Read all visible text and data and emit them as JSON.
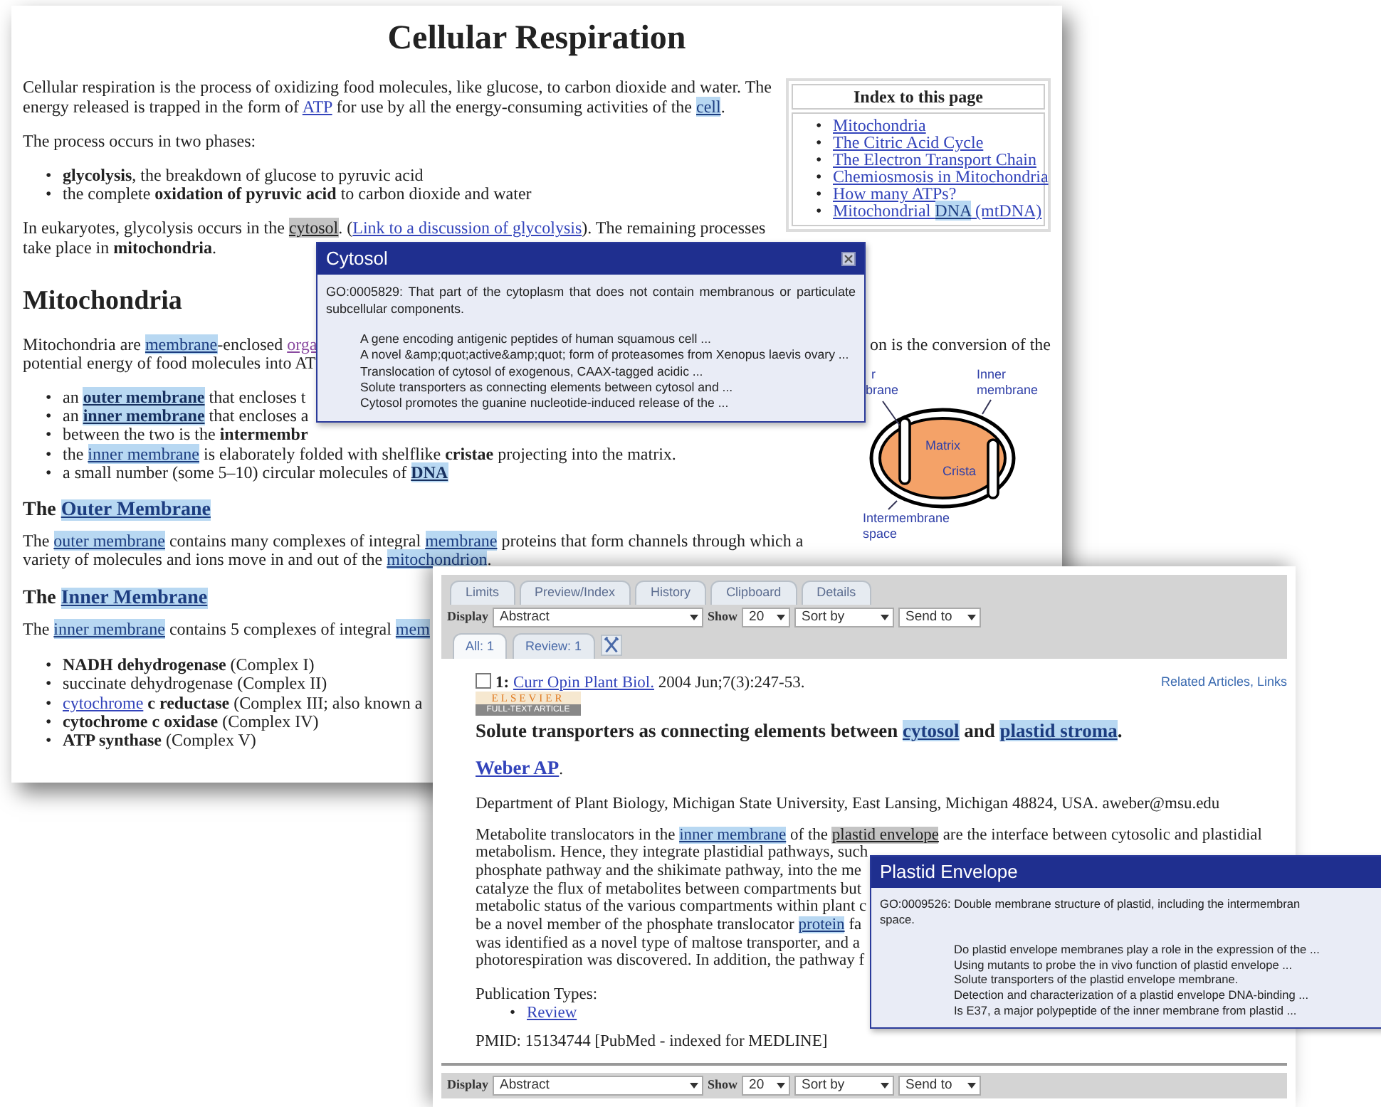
{
  "back_page": {
    "title": "Cellular Respiration",
    "intro": [
      {
        "kind": "text",
        "text": "Cellular respiration is the process of oxidizing food molecules, like glucose, to carbon dioxide and water. The energy released is trapped in the form of "
      },
      {
        "kind": "link",
        "text": "ATP"
      },
      {
        "kind": "text",
        "text": " for use by all the energy-consuming activities of the "
      },
      {
        "kind": "term",
        "text": "cell"
      },
      {
        "kind": "text",
        "text": "."
      }
    ],
    "phases_intro": "The process occurs in two phases:",
    "phases": [
      {
        "bullet": "•",
        "parts": [
          {
            "kind": "text",
            "text": "**glycolysis**, the breakdown of glucose to pyruvic acid"
          }
        ]
      },
      {
        "bullet": "•",
        "parts": [
          {
            "kind": "text",
            "text": "the complete **oxidation of pyruvic acid** to carbon dioxide and water"
          }
        ]
      }
    ],
    "eukaryotes": [
      {
        "kind": "text",
        "text": "In eukaryotes, glycolysis occurs in the "
      },
      {
        "kind": "hover",
        "text": "cytosol"
      },
      {
        "kind": "text",
        "text": ". ("
      },
      {
        "kind": "link",
        "text": "Link to a discussion of glycolysis"
      },
      {
        "kind": "text",
        "text": "). The remaining processes take place in **mitochondria**."
      }
    ],
    "index": {
      "heading": "Index to this page",
      "links": [
        {
          "bullet": "•",
          "parts": [
            {
              "kind": "link",
              "text": "Mitochondria"
            }
          ]
        },
        {
          "bullet": "•",
          "parts": [
            {
              "kind": "link",
              "text": "The Citric Acid Cycle"
            }
          ]
        },
        {
          "bullet": "•",
          "parts": [
            {
              "kind": "link",
              "text": "The Electron Transport Chain"
            }
          ]
        },
        {
          "bullet": "•",
          "parts": [
            {
              "kind": "link",
              "text": "Chemiosmosis in Mitochondria"
            }
          ]
        },
        {
          "bullet": "•",
          "parts": [
            {
              "kind": "link",
              "text": "How many ATPs?"
            }
          ]
        },
        {
          "bullet": "•",
          "parts": [
            {
              "kind": "link",
              "text": "Mitochondrial "
            },
            {
              "kind": "term",
              "text": "DNA"
            },
            {
              "kind": "link",
              "text": " (mtDNA)"
            }
          ]
        }
      ]
    },
    "section_heading": "Mitochondria",
    "mito_lines": [
      {
        "left": [
          {
            "kind": "text",
            "text": "Mitochondria are "
          },
          {
            "kind": "term",
            "text": "membrane"
          },
          {
            "kind": "text",
            "text": "-enclosed "
          },
          {
            "kind": "visited",
            "text": "orga"
          }
        ],
        "right": [
          {
            "kind": "text",
            "text": "on is the conversion of the"
          }
        ]
      },
      {
        "left": [
          {
            "kind": "text",
            "text": "potential energy of food molecules into AT"
          }
        ]
      }
    ],
    "mito_bullets": [
      {
        "bullet": "•",
        "parts": [
          {
            "kind": "text",
            "text": "an "
          },
          {
            "kind": "term_bold",
            "text": "outer membrane"
          },
          {
            "kind": "text",
            "text": " that encloses t"
          }
        ]
      },
      {
        "bullet": "•",
        "parts": [
          {
            "kind": "text",
            "text": "an "
          },
          {
            "kind": "term_bold",
            "text": "inner membrane"
          },
          {
            "kind": "text",
            "text": " that encloses a"
          }
        ]
      },
      {
        "bullet": "•",
        "parts": [
          {
            "kind": "text",
            "text": "between the two is the **intermembr**"
          }
        ]
      },
      {
        "bullet": "•",
        "parts": [
          {
            "kind": "text",
            "text": "the "
          },
          {
            "kind": "term",
            "text": "inner membrane"
          },
          {
            "kind": "text",
            "text": " is elaborately folded with shelflike **cristae** projecting into the matrix."
          }
        ]
      },
      {
        "bullet": "•",
        "parts": [
          {
            "kind": "text",
            "text": "a small number (some 5–10) circular molecules of "
          },
          {
            "kind": "term_bold",
            "text": "DNA"
          }
        ]
      }
    ],
    "outer_heading": [
      {
        "kind": "text",
        "text": "The "
      },
      {
        "kind": "term",
        "text": "Outer Membrane"
      }
    ],
    "outer_text": [
      {
        "kind": "text",
        "text": "The "
      },
      {
        "kind": "term",
        "text": "outer membrane"
      },
      {
        "kind": "text",
        "text": " contains many complexes of integral "
      },
      {
        "kind": "term",
        "text": "membrane"
      },
      {
        "kind": "text",
        "text": " proteins that form channels through which a variety of molecules and ions move in and out of the "
      },
      {
        "kind": "term",
        "text": "mitochondrion"
      },
      {
        "kind": "text",
        "text": "."
      }
    ],
    "inner_heading": [
      {
        "kind": "text",
        "text": "The "
      },
      {
        "kind": "term",
        "text": "Inner Membrane"
      }
    ],
    "inner_text": [
      {
        "kind": "text",
        "text": "The "
      },
      {
        "kind": "term",
        "text": "inner membrane"
      },
      {
        "kind": "text",
        "text": " contains 5 complexes of integral "
      },
      {
        "kind": "term",
        "text": "mem"
      }
    ],
    "complexes": [
      {
        "bullet": "•",
        "parts": [
          {
            "kind": "text",
            "text": "**NADH dehydrogenase** (Complex I)"
          }
        ]
      },
      {
        "bullet": "•",
        "parts": [
          {
            "kind": "text",
            "text": "succinate dehydrogenase (Complex II)"
          }
        ]
      },
      {
        "bullet": "•",
        "parts": [
          {
            "kind": "link",
            "text": "cytochrome"
          },
          {
            "kind": "text",
            "text": " **c reductase** (Complex III; also known a"
          }
        ]
      },
      {
        "bullet": "•",
        "parts": [
          {
            "kind": "text",
            "text": "**cytochrome c oxidase** (Complex IV)"
          }
        ]
      },
      {
        "bullet": "•",
        "parts": [
          {
            "kind": "text",
            "text": "**ATP synthase** (Complex V)"
          }
        ]
      }
    ],
    "diagram": {
      "labels": [
        {
          "kind": "edge",
          "lines": [
            "r",
            "brane"
          ]
        },
        {
          "kind": "inner",
          "lines": [
            "Inner",
            "membrane"
          ]
        },
        {
          "kind": "matrix",
          "lines": [
            "Matrix"
          ]
        },
        {
          "kind": "crista",
          "lines": [
            "Crista"
          ]
        },
        {
          "kind": "space",
          "lines": [
            "Intermembrane",
            "space"
          ]
        }
      ]
    }
  },
  "cytosol_popup": {
    "title": "Cytosol",
    "definition": "GO:0005829: That part of the cytoplasm that does not contain membranous or particulate subcellular components.",
    "links": [
      "A gene encoding antigenic peptides of human squamous cell ...",
      "A novel &amp;quot;active&amp;quot; form of proteasomes from Xenopus laevis ovary ...",
      "Translocation of cytosol of exogenous, CAAX-tagged acidic ...",
      "Solute transporters as connecting elements between cytosol and ...",
      "Cytosol promotes the guanine nucleotide-induced release of the ..."
    ]
  },
  "front_page": {
    "tabs": [
      {
        "label": "Limits",
        "selected": false
      },
      {
        "label": "Preview/Index",
        "selected": false
      },
      {
        "label": "History",
        "selected": false
      },
      {
        "label": "Clipboard",
        "selected": false
      },
      {
        "label": "Details",
        "selected": false
      }
    ],
    "toolbars": [
      {
        "display_label": "Display",
        "display_value": "Abstract",
        "show_label": "Show",
        "show_value": "20",
        "sort": "Sort by",
        "send": "Send to"
      },
      {
        "display_label": "Display",
        "display_value": "Abstract",
        "show_label": "Show",
        "show_value": "20",
        "sort": "Sort by",
        "send": "Send to"
      }
    ],
    "result_tabs": [
      {
        "label": "All: 1",
        "selected": true
      },
      {
        "label": "Review: 1",
        "selected": false
      }
    ],
    "record": {
      "checked": false,
      "number": "1:",
      "journal": "Curr Opin Plant Biol.",
      "citation": "2004 Jun;7(3):247-53.",
      "related": "Related Articles, Links",
      "logo": "ELSEVIER",
      "logo_badge": "FULL-TEXT ARTICLE",
      "title": [
        {
          "kind": "text",
          "text": "Solute transporters as connecting elements between "
        },
        {
          "kind": "term",
          "text": "cytosol"
        },
        {
          "kind": "text",
          "text": " and "
        },
        {
          "kind": "term",
          "text": "plastid stroma"
        },
        {
          "kind": "text",
          "text": "."
        }
      ],
      "author": "Weber AP",
      "author_end": ".",
      "affiliation": "Department of Plant Biology, Michigan State University, East Lansing, Michigan 48824, USA. aweber@msu.edu",
      "abstract_lines": [
        [
          {
            "kind": "text",
            "text": "Metabolite translocators in the "
          },
          {
            "kind": "term",
            "text": "inner membrane"
          },
          {
            "kind": "text",
            "text": " of the "
          },
          {
            "kind": "hover",
            "text": "plastid envelope"
          },
          {
            "kind": "text",
            "text": " are the interface between cytosolic and plastidial"
          }
        ],
        [
          {
            "kind": "text",
            "text": "metabolism. Hence, they integrate plastidial pathways, such"
          }
        ],
        [
          {
            "kind": "text",
            "text": "phosphate pathway and the shikimate pathway, into the me"
          }
        ],
        [
          {
            "kind": "text",
            "text": "catalyze the flux of metabolites between compartments but"
          }
        ],
        [
          {
            "kind": "text",
            "text": "metabolic status of the various compartments within plant c"
          }
        ],
        [
          {
            "kind": "text",
            "text": "be a novel member of the phosphate translocator "
          },
          {
            "kind": "term",
            "text": "protein"
          },
          {
            "kind": "text",
            "text": " fa"
          }
        ],
        [
          {
            "kind": "text",
            "text": "was identified as a novel type of maltose transporter, and a"
          }
        ],
        [
          {
            "kind": "text",
            "text": "photorespiration was discovered. In addition, the pathway f"
          }
        ]
      ],
      "pub_types_label": "Publication Types:",
      "pub_types": [
        {
          "bullet": "•",
          "text": "Review"
        }
      ],
      "pmid": "PMID: 15134744 [PubMed - indexed for MEDLINE]"
    }
  },
  "plastid_popup": {
    "title": "Plastid Envelope",
    "definition_lines": [
      "GO:0009526: Double membrane structure of plastid, including the intermembran",
      "space."
    ],
    "links": [
      "Do plastid envelope membranes play a role in the expression of the ...",
      "Using mutants to probe the in vivo function of plastid envelope ...",
      "Solute transporters of the plastid envelope membrane.",
      "Detection and characterization of a plastid envelope DNA-binding ...",
      "Is E37, a major polypeptide of the inner membrane from plastid ..."
    ]
  }
}
